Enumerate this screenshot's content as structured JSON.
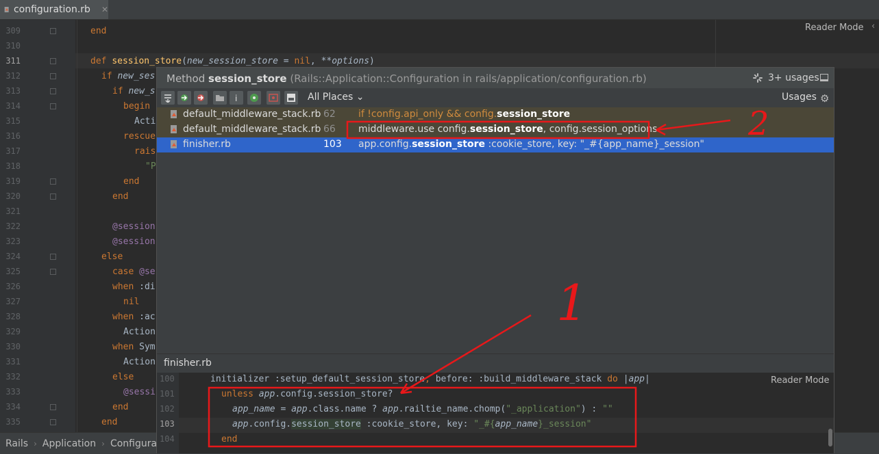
{
  "tab": {
    "filename": "configuration.rb",
    "close": "✕"
  },
  "editor": {
    "reader_mode": "Reader Mode",
    "line_numbers": [
      "309",
      "310",
      "311",
      "312",
      "313",
      "314",
      "315",
      "316",
      "317",
      "318",
      "319",
      "320",
      "321",
      "322",
      "323",
      "324",
      "325",
      "326",
      "327",
      "328",
      "329",
      "330",
      "331",
      "332",
      "333",
      "334",
      "335"
    ],
    "current_line": "311",
    "lines": {
      "l309": "end",
      "l311_def": "def ",
      "l311_name": "session_store",
      "l311_p1": "(",
      "l311_param": "new_session_store",
      "l311_mid": " = ",
      "l311_nil": "nil",
      "l311_sep": ", **",
      "l311_opts": "options",
      "l311_end": ")",
      "l312_kw": "if ",
      "l312_v": "new_ses",
      "l313_kw": "if ",
      "l313_v": "new_s",
      "l314": "begin",
      "l315": "Acti",
      "l316": "rescue",
      "l317": "rais",
      "l318": "\"P",
      "l319": "end",
      "l320": "end",
      "l322": "@session",
      "l323": "@session",
      "l324": "else",
      "l325_kw": "case ",
      "l325_v": "@se",
      "l326_kw": "when ",
      "l326_v": ":di",
      "l327": "nil",
      "l328_kw": "when ",
      "l328_v": ":ac",
      "l329": "Action",
      "l330_kw": "when ",
      "l330_v": "Sym",
      "l331": "Action",
      "l332": "else",
      "l333": "@sessi",
      "l334": "end",
      "l335": "end"
    }
  },
  "breadcrumbs": [
    "Rails",
    "Application",
    "Configura"
  ],
  "popup": {
    "title_prefix": "Method ",
    "title_method": "session_store",
    "title_context": " (Rails::Application::Configuration in rails/application/configuration.rb)",
    "usages_count": "3+ usages",
    "scope": "All Places ⌄",
    "usages_label": "Usages",
    "results": [
      {
        "file": "default_middleware_stack.rb",
        "line": "62",
        "code_pre": "if !config.api_only && config.",
        "code_bold": "session_store",
        "code_post": ""
      },
      {
        "file": "default_middleware_stack.rb",
        "line": "66",
        "code_pre": "middleware.use config.",
        "code_bold": "session_store",
        "code_post": ", config.session_options"
      },
      {
        "file": "finisher.rb",
        "line": "103",
        "code_pre": "app.config.",
        "code_bold": "session_store",
        "code_post": " :cookie_store, key: \"_#{app_name}_session\""
      }
    ],
    "preview": {
      "filename": "finisher.rb",
      "reader_mode": "Reader Mode",
      "line_numbers": [
        "100",
        "101",
        "102",
        "103",
        "104"
      ],
      "l100_a": "initializer ",
      "l100_b": ":setup_default_session_store",
      "l100_c": ", ",
      "l100_d": "before: ",
      "l100_e": ":build_middleware_stack ",
      "l100_f": "do ",
      "l100_g": "|",
      "l100_h": "app",
      "l100_i": "|",
      "l101_a": "unless ",
      "l101_b": "app",
      "l101_c": ".config.session_store?",
      "l102_a": "app_name",
      "l102_b": " = ",
      "l102_c": "app",
      "l102_d": ".class.name ? ",
      "l102_e": "app",
      "l102_f": ".railtie_name.chomp(",
      "l102_g": "\"_application\"",
      "l102_h": ") : ",
      "l102_i": "\"\"",
      "l103_a": "app",
      "l103_b": ".config.",
      "l103_c": "session_store",
      "l103_d": " :cookie_store, ",
      "l103_e": "key: ",
      "l103_f": "\"_#{",
      "l103_g": "app_name",
      "l103_h": "}_session\"",
      "l104": "end"
    }
  },
  "annotations": {
    "label_1": "1",
    "label_2": "2"
  },
  "colors": {
    "accent_red": "#e8181a",
    "selection": "#2f65ca",
    "highlight_row": "#4b4737"
  }
}
